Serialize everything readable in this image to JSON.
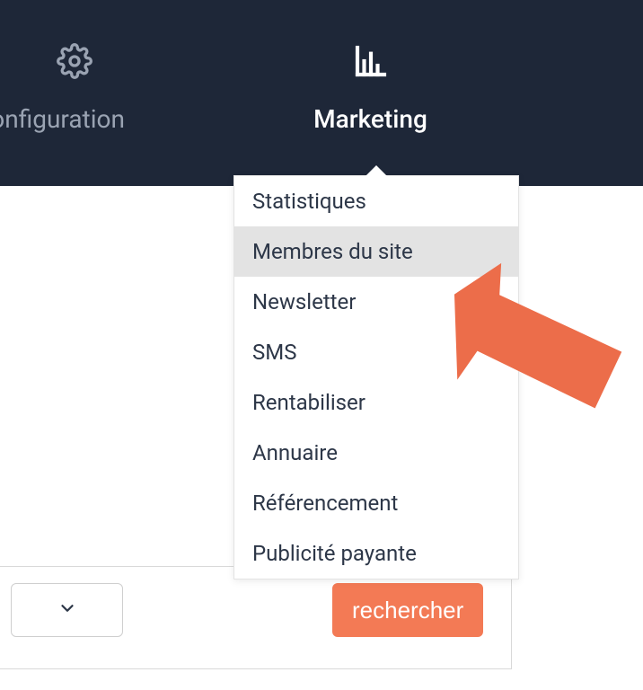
{
  "nav": {
    "config_label": "Configuration",
    "marketing_label": "Marketing"
  },
  "dropdown": {
    "items": [
      {
        "label": "Statistiques",
        "highlighted": false
      },
      {
        "label": "Membres du site",
        "highlighted": true
      },
      {
        "label": "Newsletter",
        "highlighted": false
      },
      {
        "label": "SMS",
        "highlighted": false
      },
      {
        "label": "Rentabiliser",
        "highlighted": false
      },
      {
        "label": "Annuaire",
        "highlighted": false
      },
      {
        "label": "Référencement",
        "highlighted": false
      },
      {
        "label": "Publicité payante",
        "highlighted": false
      }
    ]
  },
  "controls": {
    "search_label": "rechercher"
  },
  "colors": {
    "topbar_bg": "#1e2738",
    "accent": "#f37a55",
    "highlight": "#e3e3e3"
  }
}
